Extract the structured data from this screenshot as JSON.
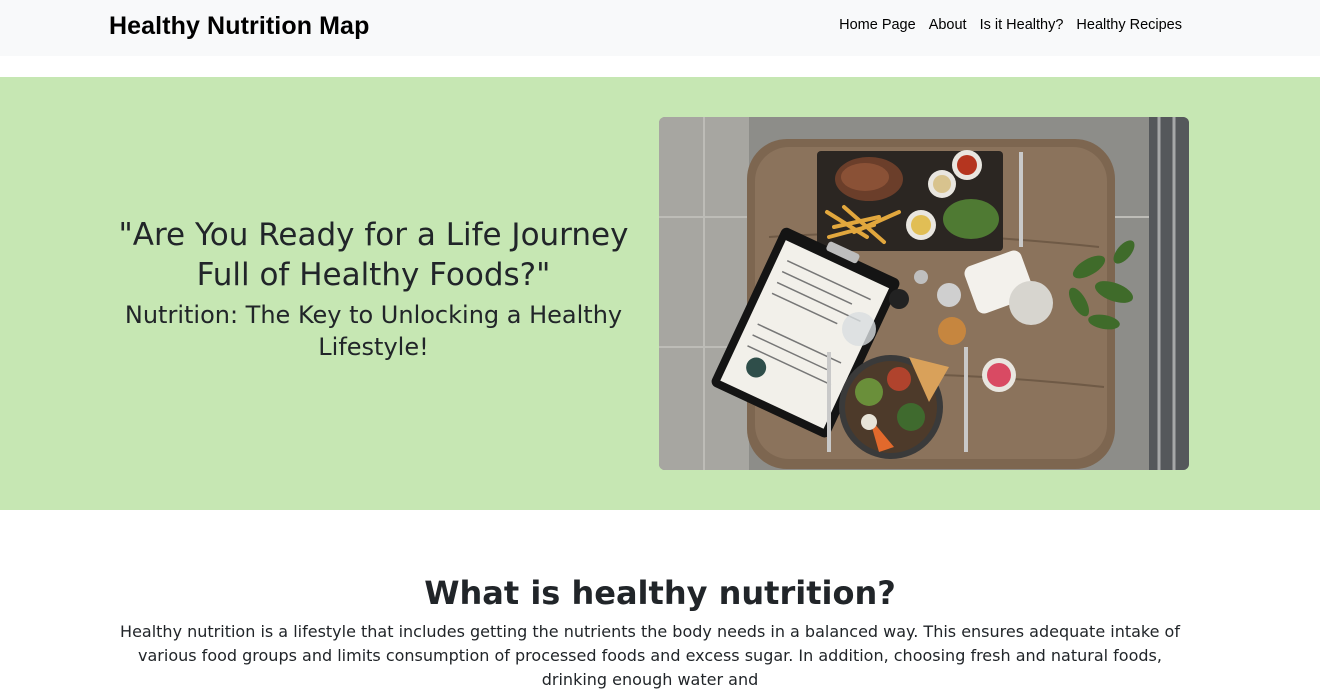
{
  "navbar": {
    "brand": "Healthy Nutrition Map",
    "links": [
      "Home Page",
      "About",
      "Is it Healthy?",
      "Healthy Recipes"
    ]
  },
  "hero": {
    "quote": "\"Are You Ready for a Life Journey Full of Healthy Foods?\"",
    "subtitle": "Nutrition: The Key to Unlocking a Healthy Lifestyle!",
    "background_color": "#c6e7b3",
    "image_description_icon": "food-table-photo"
  },
  "section": {
    "title": "What is healthy nutrition?",
    "body": "Healthy nutrition is a lifestyle that includes getting the nutrients the body needs in a balanced way. This ensures adequate intake of various food groups and limits consumption of processed foods and excess sugar. In addition, choosing fresh and natural foods, drinking enough water and"
  }
}
